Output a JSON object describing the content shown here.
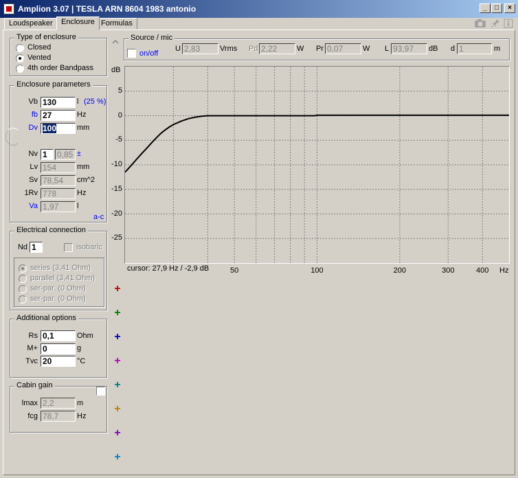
{
  "window": {
    "title": "Amplion 3.07  |  TESLA ARN 8604 1983 antonio"
  },
  "tabs": [
    {
      "label": "Loudspeaker",
      "active": false
    },
    {
      "label": "Enclosure",
      "active": true
    },
    {
      "label": "Formulas",
      "active": false
    }
  ],
  "enclosure_type": {
    "title": "Type of enclosure",
    "options": [
      {
        "label": "Closed",
        "selected": false
      },
      {
        "label": "Vented",
        "selected": true
      },
      {
        "label": "4th order Bandpass",
        "selected": false
      }
    ]
  },
  "enclosure_params": {
    "title": "Enclosure parameters",
    "vb": {
      "label": "Vb",
      "value": "130",
      "unit": "l",
      "extra": "(25 %)"
    },
    "fb": {
      "label": "fb",
      "value": "27",
      "unit": "Hz"
    },
    "dv": {
      "label": "Dv",
      "value": "100",
      "unit": "mm"
    },
    "nv": {
      "label": "Nv",
      "value": "1",
      "value2": "0,85",
      "unit": "±"
    },
    "lv": {
      "label": "Lv",
      "value": "154",
      "unit": "mm"
    },
    "sv": {
      "label": "Sv",
      "value": "78,54",
      "unit": "cm^2"
    },
    "rv": {
      "label": "1Rv",
      "value": "778",
      "unit": "Hz"
    },
    "va": {
      "label": "Va",
      "value": "1,97",
      "unit": "l"
    },
    "ac_link": "a-c"
  },
  "electrical": {
    "title": "Electrical connection",
    "nd_label": "Nd",
    "nd_value": "1",
    "isobaric_label": "isobaric",
    "options": [
      {
        "label": "series (3,41 Ohm)",
        "selected": true
      },
      {
        "label": "parallel (3,41 Ohm)",
        "selected": false
      },
      {
        "label": "ser-par. (0 Ohm)",
        "selected": false
      },
      {
        "label": "ser-par. (0 Ohm)",
        "selected": false
      }
    ]
  },
  "additional": {
    "title": "Additional options",
    "rs": {
      "label": "Rs",
      "value": "0,1",
      "unit": "Ohm"
    },
    "mplus": {
      "label": "M+",
      "value": "0",
      "unit": "g"
    },
    "tvc": {
      "label": "Tvc",
      "value": "20",
      "unit": "°C"
    }
  },
  "cabin": {
    "title": "Cabin gain",
    "lmax": {
      "label": "lmax",
      "value": "2,2",
      "unit": "m"
    },
    "fcg": {
      "label": "fcg",
      "value": "78,7",
      "unit": "Hz"
    }
  },
  "source": {
    "title": "Source / mic",
    "onoff_label": "on/off",
    "u": {
      "label": "U",
      "value": "2,83",
      "unit": "Vrms"
    },
    "pd": {
      "label": "Pd",
      "value": "2,22",
      "unit": "W"
    },
    "pr": {
      "label": "Pr",
      "value": "0,07",
      "unit": "W"
    },
    "l": {
      "label": "L",
      "value": "93,97",
      "unit": "dB"
    },
    "d": {
      "label": "d",
      "value": "1",
      "unit": "m"
    }
  },
  "plus_colors": [
    "#c00000",
    "#008000",
    "#0000c0",
    "#c000c0",
    "#008080",
    "#c08000",
    "#8000c0",
    "#0080c0"
  ],
  "chart_data": {
    "type": "line",
    "xscale": "log",
    "xlim": [
      20,
      500
    ],
    "ylim": [
      -30,
      10
    ],
    "ylabel": "dB",
    "xlabel": "Hz",
    "yticks": [
      5,
      0,
      -5,
      -10,
      -15,
      -20,
      -25
    ],
    "xticks_labeled": [
      50,
      100,
      200,
      300,
      400
    ],
    "xgrid": [
      30,
      40,
      50,
      60,
      70,
      80,
      90,
      100,
      200,
      300,
      400
    ],
    "grid": true,
    "cursor_text": "cursor: 27,9 Hz / -2,9 dB",
    "series": [
      {
        "x": [
          20,
          21,
          22,
          23,
          24,
          25,
          26,
          27,
          28,
          29,
          30,
          32,
          34,
          36,
          38,
          40,
          45,
          50,
          60,
          70,
          80,
          90,
          98,
          100,
          150,
          200,
          300,
          400,
          500
        ],
        "y": [
          -11.5,
          -10.2,
          -8.9,
          -7.7,
          -6.6,
          -5.5,
          -4.5,
          -3.6,
          -2.9,
          -2.3,
          -1.8,
          -1.1,
          -0.6,
          -0.3,
          -0.1,
          0.0,
          0.0,
          0.0,
          0.0,
          0.0,
          0.0,
          0.0,
          0.0,
          0.1,
          0.1,
          0.1,
          0.1,
          0.1,
          0.1
        ]
      }
    ]
  }
}
